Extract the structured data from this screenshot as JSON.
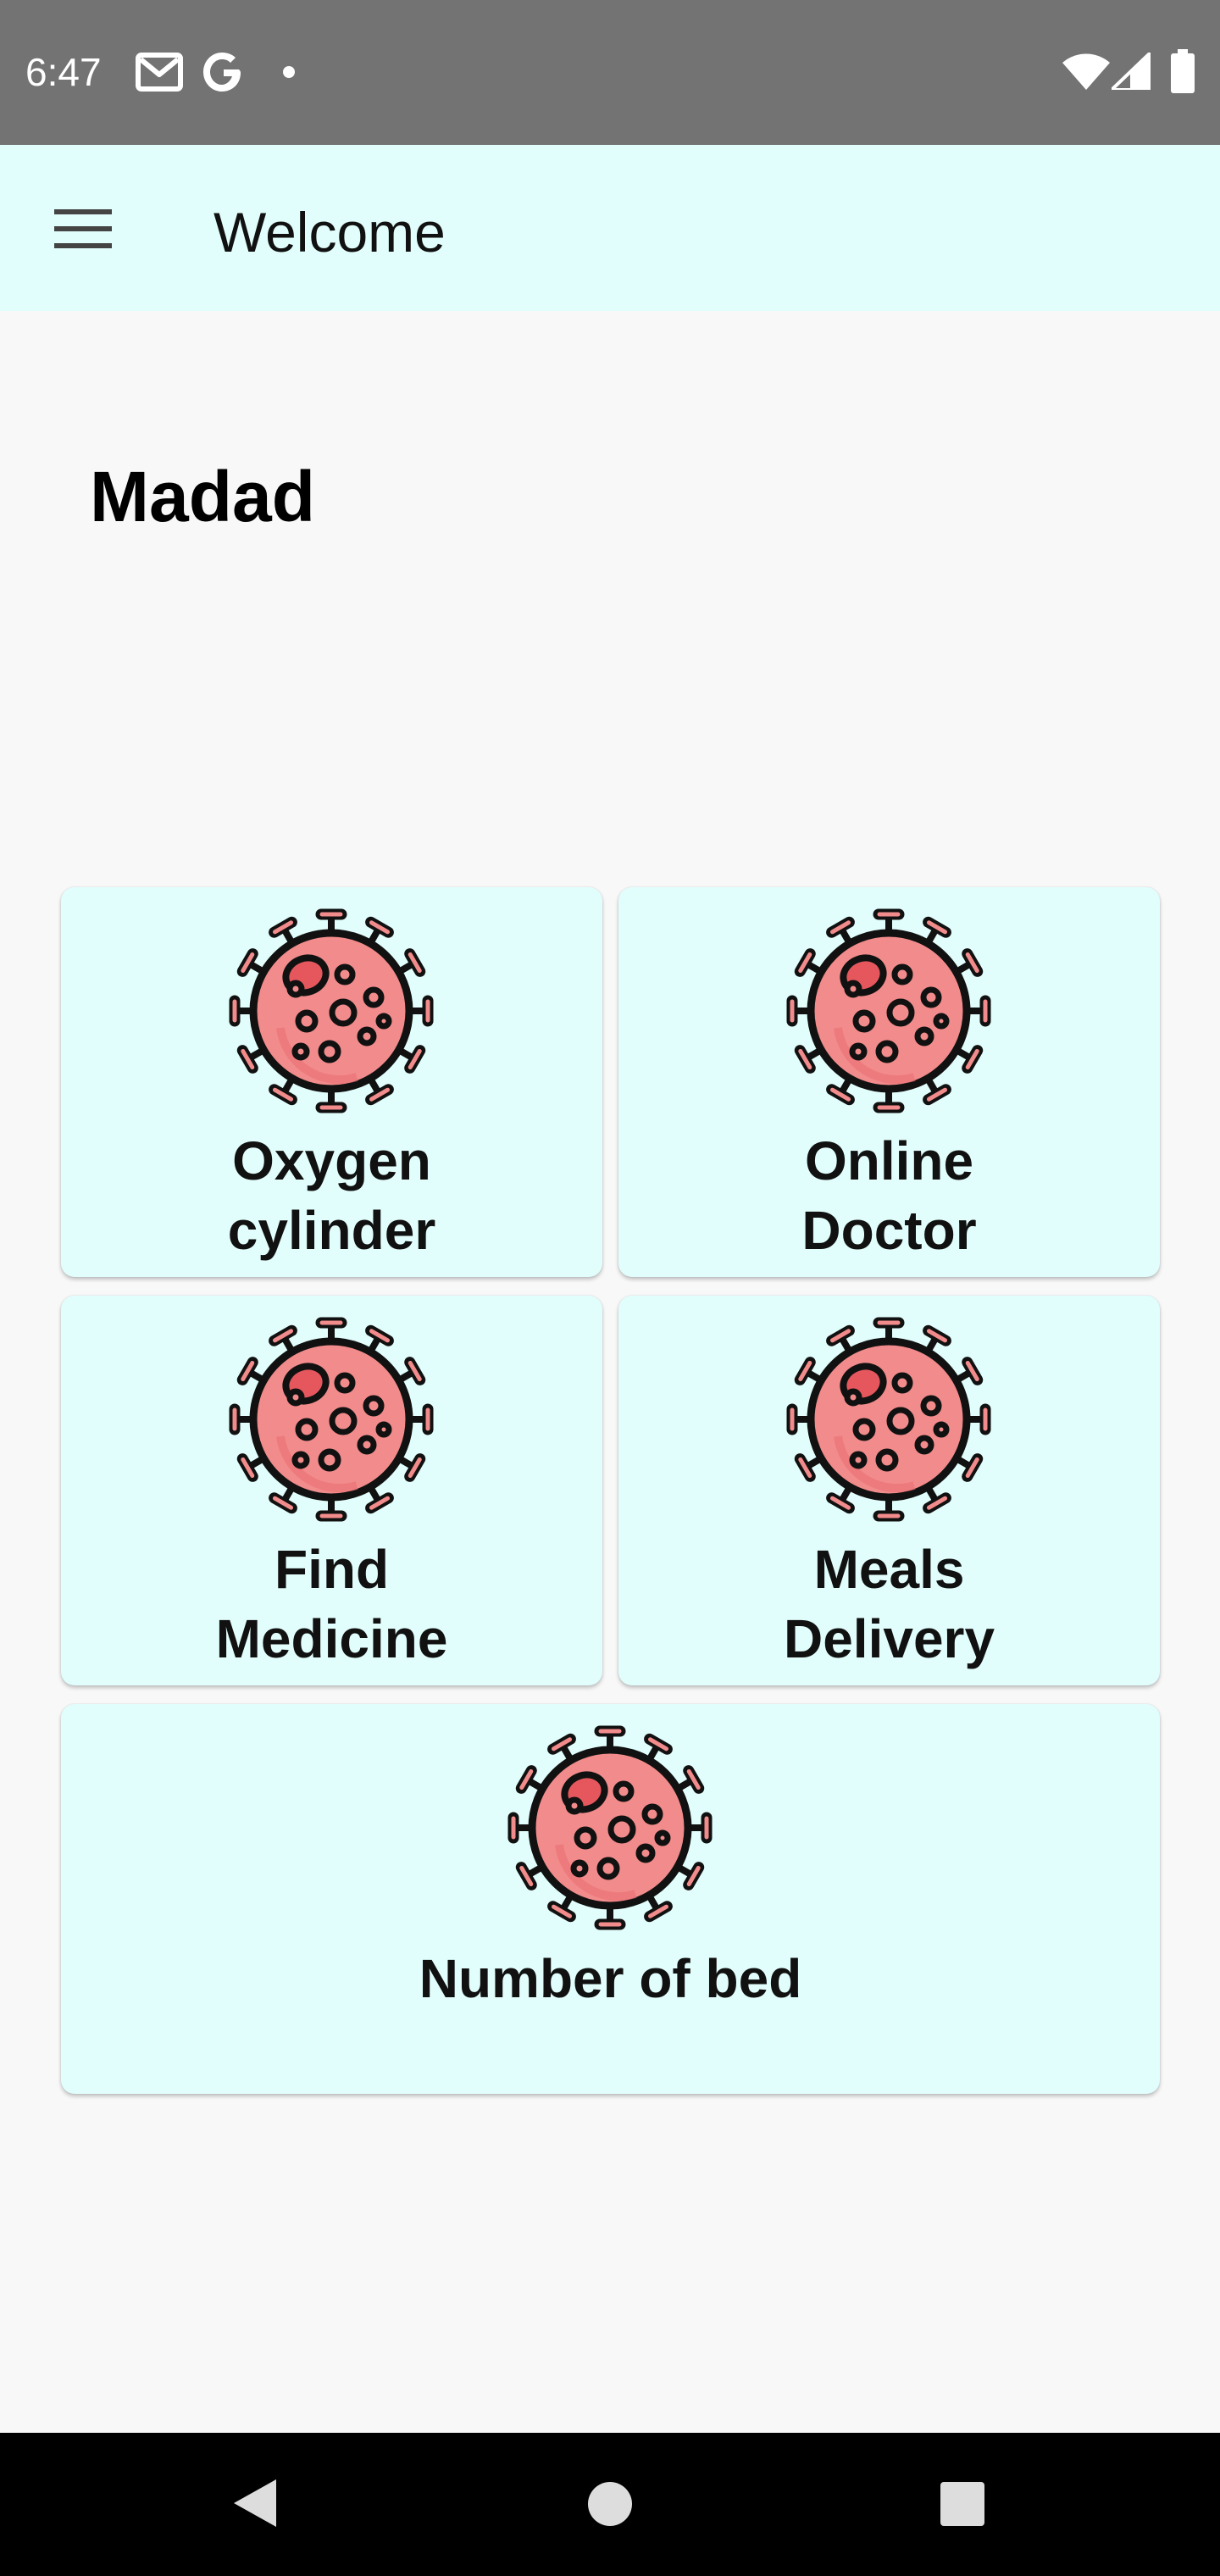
{
  "status_bar": {
    "time": "6:47",
    "left_icons": [
      "gmail-icon",
      "google-icon",
      "notification-dot-icon"
    ],
    "right_icons": [
      "wifi-icon",
      "signal-icon",
      "battery-icon"
    ]
  },
  "app_bar": {
    "menu_icon": "hamburger-menu-icon",
    "title": "Welcome"
  },
  "main": {
    "heading": "Madad",
    "cards": [
      {
        "line1": "Oxygen",
        "line2": "cylinder",
        "icon": "virus-icon"
      },
      {
        "line1": "Online",
        "line2": "Doctor",
        "icon": "virus-icon"
      },
      {
        "line1": "Find",
        "line2": "Medicine",
        "icon": "virus-icon"
      },
      {
        "line1": "Meals",
        "line2": "Delivery",
        "icon": "virus-icon"
      },
      {
        "label": "Number of bed",
        "icon": "virus-icon"
      }
    ]
  },
  "nav_bar": {
    "icons": [
      "back-icon",
      "home-icon",
      "recents-icon"
    ]
  },
  "colors": {
    "status_bar": "#737373",
    "app_bar": "#e1fefc",
    "card_background": "#e1fefc",
    "background": "#f8f8f8",
    "virus_fill": "#f28b8b",
    "virus_spot": "#e5575d",
    "nav_bar": "#000000"
  }
}
